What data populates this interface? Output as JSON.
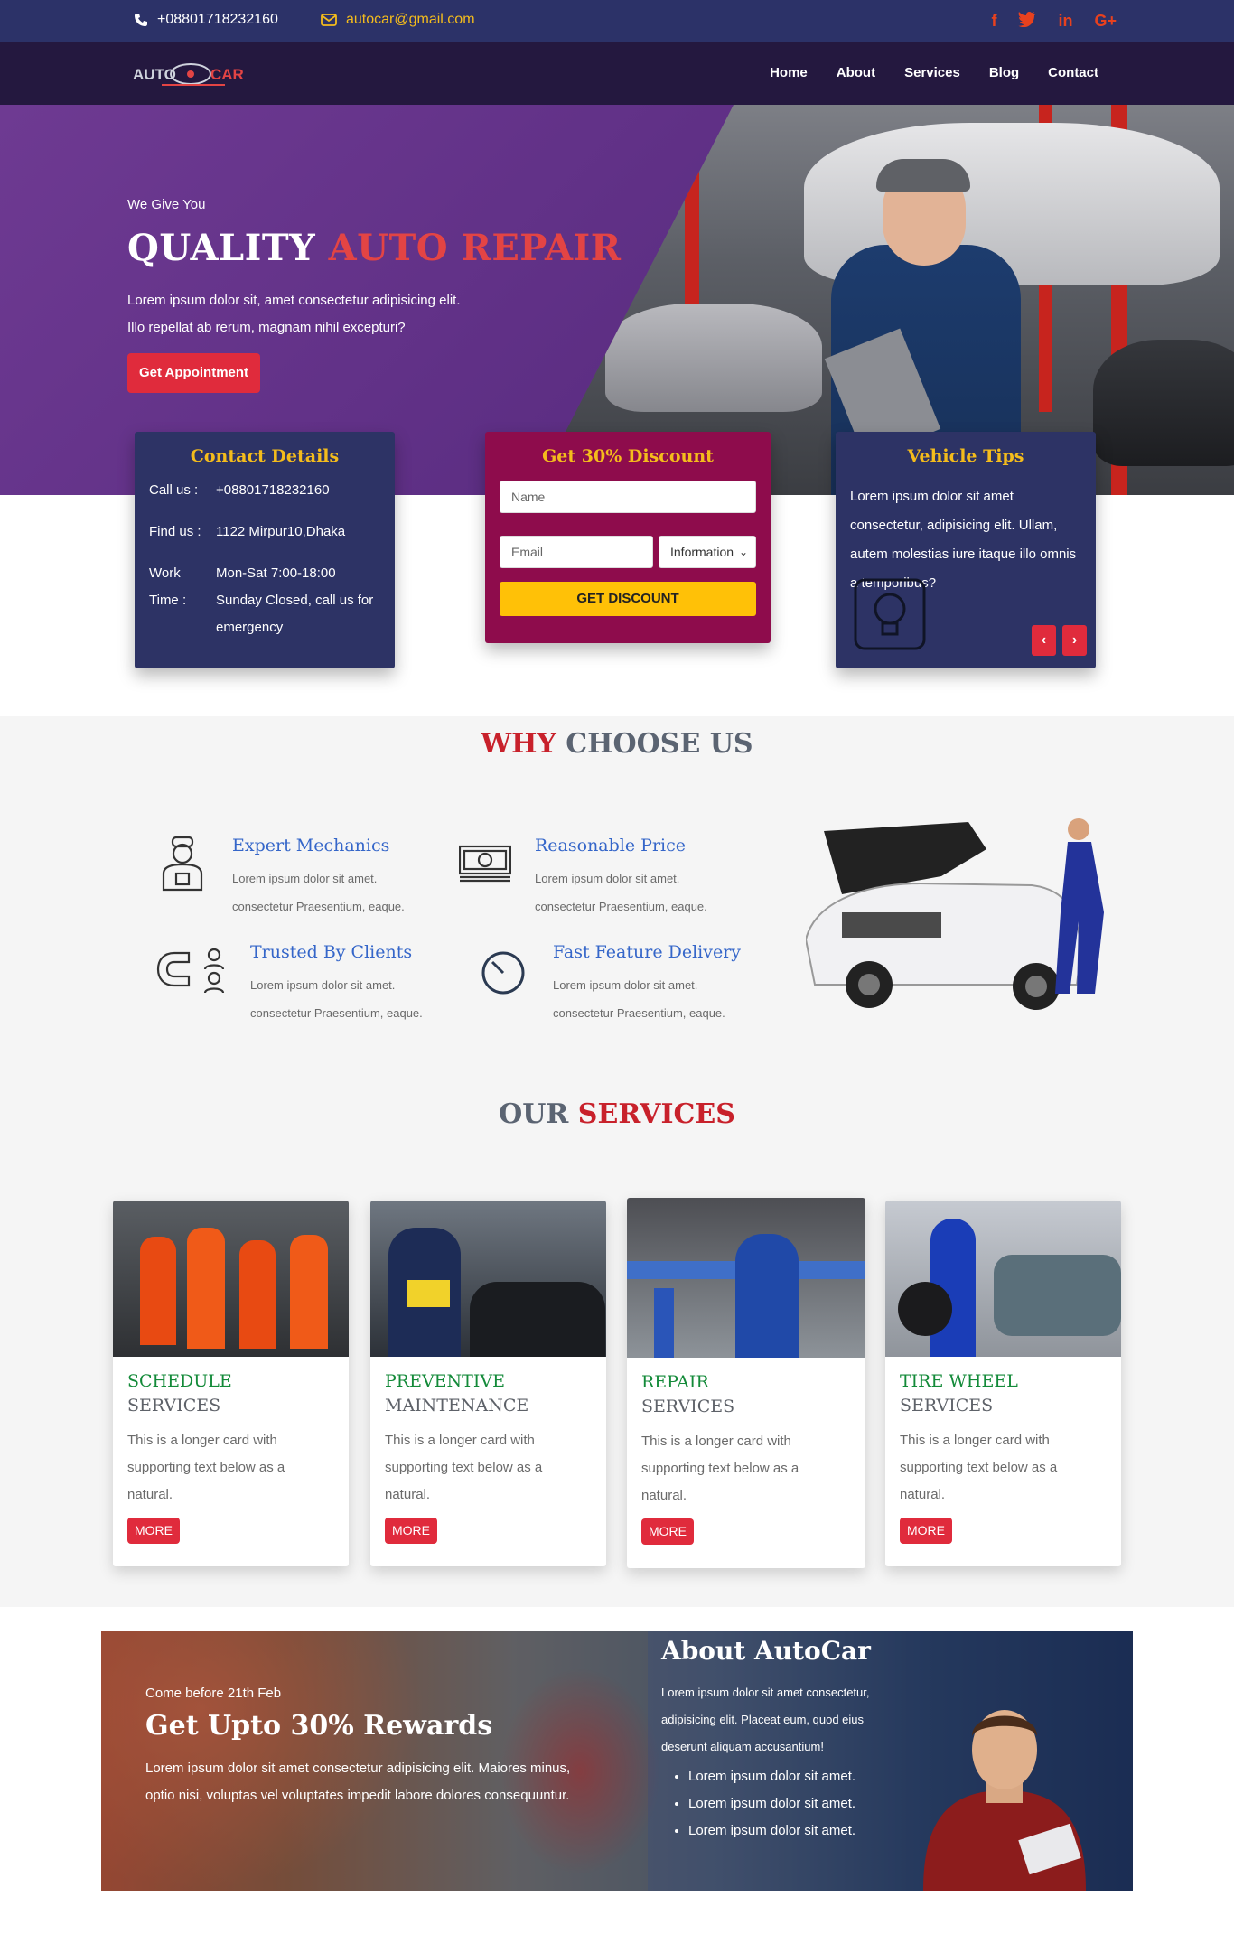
{
  "topbar": {
    "phone": "+08801718232160",
    "email": "autocar@gmail.com",
    "social": [
      {
        "icon": "facebook-icon",
        "glyph": "f"
      },
      {
        "icon": "twitter-icon",
        "glyph": "t"
      },
      {
        "icon": "linkedin-icon",
        "glyph": "in"
      },
      {
        "icon": "google-plus-icon",
        "glyph": "G+"
      }
    ]
  },
  "navbar": {
    "logo_text": "AUTO CAR",
    "links": [
      "Home",
      "About",
      "Services",
      "Blog",
      "Contact"
    ]
  },
  "hero": {
    "tagline": "We Give You",
    "title_white": "QUALITY",
    "title_red": "AUTO REPAIR",
    "desc_line1": "Lorem ipsum dolor sit, amet consectetur adipisicing elit.",
    "desc_line2": "Illo repellat ab rerum, magnam nihil excepturi?",
    "button": "Get Appointment"
  },
  "contact_card": {
    "title": "Contact Details",
    "call_label": "Call us :",
    "call_value": "+08801718232160",
    "find_label": "Find us :",
    "find_value": "1122 Mirpur10,Dhaka",
    "work_label_1": "Work",
    "work_label_2": "Time :",
    "work_value_1": "Mon-Sat 7:00-18:00",
    "work_value_2": "Sunday Closed, call us for emergency"
  },
  "discount_card": {
    "title": "Get 30% Discount",
    "name_placeholder": "Name",
    "email_placeholder": "Email",
    "select_value": "Information",
    "button": "GET DISCOUNT"
  },
  "tips_card": {
    "title": "Vehicle Tips",
    "text": "Lorem ipsum dolor sit amet consectetur, adipisicing elit. Ullam, autem molestias iure itaque illo omnis a temporibus?",
    "prev": "‹",
    "next": "›"
  },
  "why": {
    "title_red": "WHY",
    "title_grey": "CHOOSE US",
    "features": [
      {
        "title": "Expert Mechanics",
        "line1": "Lorem ipsum dolor sit amet.",
        "line2": "consectetur Praesentium, eaque."
      },
      {
        "title": "Reasonable Price",
        "line1": "Lorem ipsum dolor sit amet.",
        "line2": "consectetur Praesentium, eaque."
      },
      {
        "title": "Trusted By Clients",
        "line1": "Lorem ipsum dolor sit amet.",
        "line2": "consectetur Praesentium, eaque."
      },
      {
        "title": "Fast Feature Delivery",
        "line1": "Lorem ipsum dolor sit amet.",
        "line2": "consectetur Praesentium, eaque."
      }
    ]
  },
  "services": {
    "title_grey": "OUR",
    "title_red": "SERVICES",
    "cards": [
      {
        "title": "SCHEDULE",
        "sub": "SERVICES",
        "text": "This is a longer card with supporting text below as a natural.",
        "button": "MORE"
      },
      {
        "title": "PREVENTIVE",
        "sub": "MAINTENANCE",
        "text": "This is a longer card with supporting text below as a natural.",
        "button": "MORE"
      },
      {
        "title": "REPAIR",
        "sub": "SERVICES",
        "text": "This is a longer card with supporting text below as a natural.",
        "button": "MORE"
      },
      {
        "title": "TIRE WHEEL",
        "sub": "SERVICES",
        "text": "This is a longer card with supporting text below as a natural.",
        "button": "MORE"
      }
    ]
  },
  "banner": {
    "small": "Come before 21th Feb",
    "big": "Get Upto 30% Rewards",
    "desc": "Lorem ipsum dolor sit amet consectetur adipisicing elit. Maiores minus, optio nisi, voluptas vel voluptates impedit labore dolores consequuntur.",
    "about_title": "About AutoCar",
    "about_desc": "Lorem ipsum dolor sit amet consectetur, adipisicing elit. Placeat eum, quod eius deserunt aliquam accusantium!",
    "about_list": [
      "Lorem ipsum dolor sit amet.",
      "Lorem ipsum dolor sit amet.",
      "Lorem ipsum dolor sit amet."
    ]
  },
  "colors": {
    "topbar": "#2c3268",
    "navbar": "#24183f",
    "accent_red": "#e02b3c",
    "accent_yellow": "#f4bc1c",
    "card_navy": "#2d3365",
    "card_maroon": "#8e0c4c"
  }
}
